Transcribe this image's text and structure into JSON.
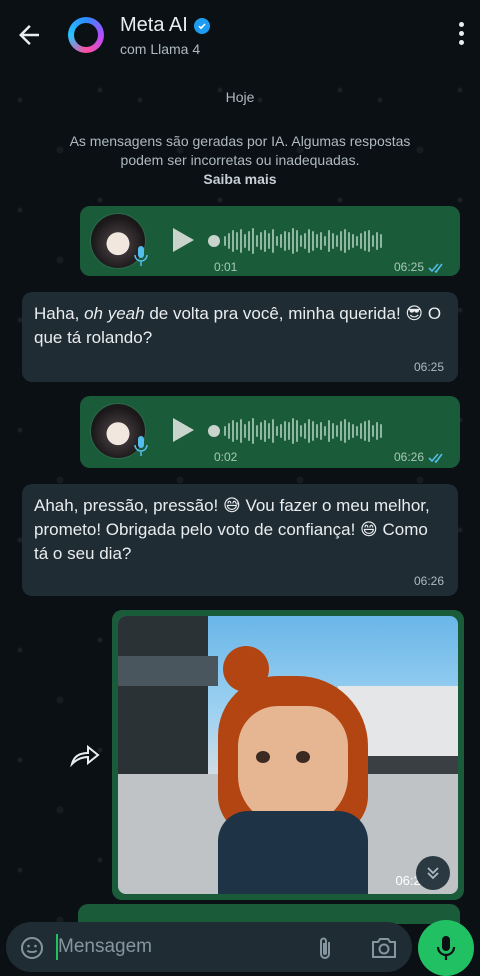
{
  "header": {
    "title": "Meta AI",
    "subtitle": "com Llama 4"
  },
  "chat": {
    "date_label": "Hoje",
    "notice_text": "As mensagens são geradas por IA. Algumas respostas podem ser incorretas ou inadequadas.",
    "notice_link": "Saiba mais",
    "messages": [
      {
        "type": "voice",
        "direction": "out",
        "duration": "0:01",
        "time": "06:25"
      },
      {
        "type": "text",
        "direction": "in",
        "text_pre": "Haha, ",
        "text_em": "oh yeah",
        "text_post": " de volta pra você, minha querida! 😎 O que tá rolando?",
        "time": "06:25"
      },
      {
        "type": "voice",
        "direction": "out",
        "duration": "0:02",
        "time": "06:26"
      },
      {
        "type": "text",
        "direction": "in",
        "text": "Ahah, pressão, pressão! 😅 Vou fazer o meu melhor, prometo! Obrigada pelo voto de confiança! 😄 Como tá o seu dia?",
        "time": "06:26"
      },
      {
        "type": "video",
        "direction": "out",
        "time": "06:26"
      }
    ]
  },
  "input": {
    "placeholder": "Mensagem"
  },
  "colors": {
    "outgoing_bubble": "#1a5c3a",
    "incoming_bubble": "#1f2c34",
    "accent": "#21c063",
    "read_ticks": "#53bdeb"
  }
}
